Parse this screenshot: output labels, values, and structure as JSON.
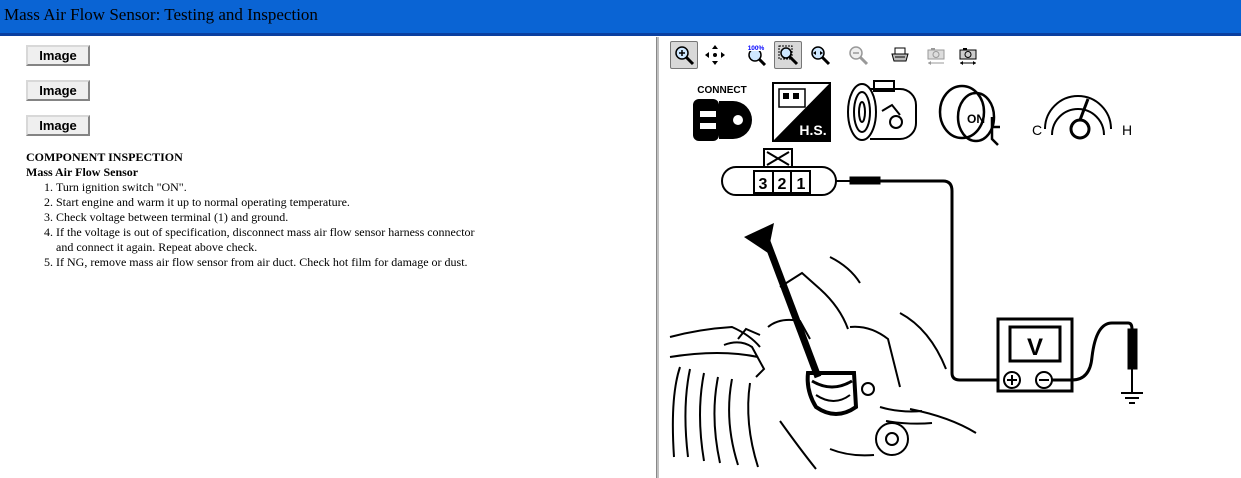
{
  "window": {
    "title": "Mass Air Flow Sensor:  Testing and Inspection"
  },
  "image_buttons": [
    "Image",
    "Image",
    "Image"
  ],
  "content": {
    "heading": "COMPONENT INSPECTION",
    "subheading": "Mass Air Flow Sensor",
    "steps": [
      "Turn ignition switch \"ON\".",
      "Start engine and warm it up to normal operating temperature.",
      "Check voltage between terminal (1) and ground.",
      "If the voltage is out of specification, disconnect mass air flow sensor harness connector and connect it again. Repeat above check.",
      "If NG, remove mass air flow sensor from air duct. Check hot film for damage or dust."
    ]
  },
  "toolbar": {
    "icons": [
      "zoom-in-icon",
      "pan-icon",
      "zoom-100-icon",
      "zoom-fit-icon",
      "zoom-width-icon",
      "zoom-out-icon",
      "print-icon",
      "copy-image-icon",
      "copy-fit-icon"
    ]
  },
  "diagram": {
    "connect_label": "CONNECT",
    "hs_label": "H.S.",
    "on_label": "ON",
    "cold_label": "C",
    "hot_label": "H",
    "terminal_3": "3",
    "terminal_2": "2",
    "terminal_1": "1",
    "meter_label": "V"
  }
}
